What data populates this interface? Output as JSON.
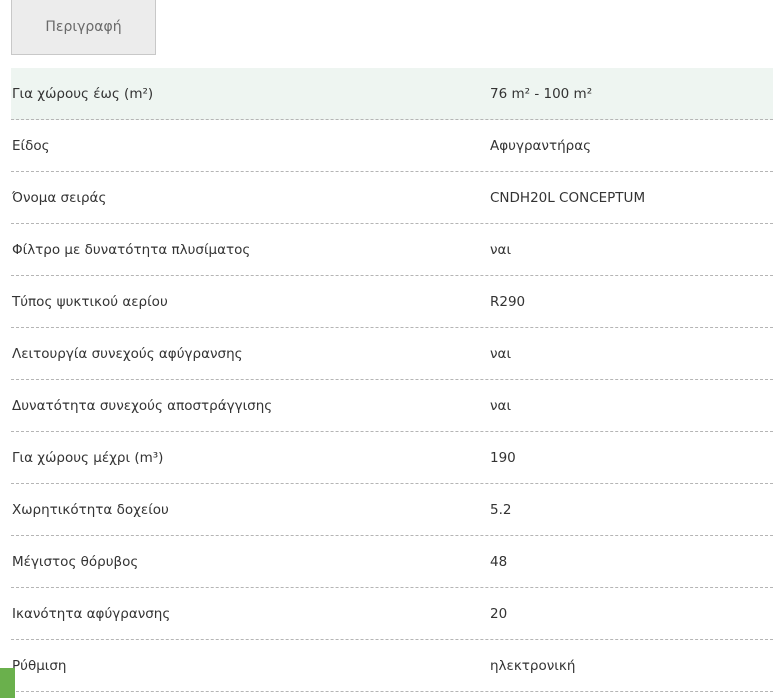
{
  "tabs": {
    "description_label": "Περιγραφή"
  },
  "specs": {
    "rows": [
      {
        "label": "Για χώρους έως (m²)",
        "value": "76 m² - 100 m²"
      },
      {
        "label": "Είδος",
        "value": "Αφυγραντήρας"
      },
      {
        "label": "Όνομα σειράς",
        "value": "CNDH20L CONCEPTUM"
      },
      {
        "label": "Φίλτρο με δυνατότητα πλυσίματος",
        "value": "ναι"
      },
      {
        "label": "Τύπος ψυκτικού αερίου",
        "value": "R290"
      },
      {
        "label": "Λειτουργία συνεχούς αφύγρανσης",
        "value": "ναι"
      },
      {
        "label": "Δυνατότητα συνεχούς αποστράγγισης",
        "value": "ναι"
      },
      {
        "label": "Για χώρους μέχρι (m³)",
        "value": "190"
      },
      {
        "label": "Χωρητικότητα δοχείου",
        "value": "5.2"
      },
      {
        "label": "Μέγιστος θόρυβος",
        "value": "48"
      },
      {
        "label": "Ικανότητα αφύγρανσης",
        "value": "20"
      },
      {
        "label": "Ρύθμιση",
        "value": "ηλεκτρονική"
      }
    ]
  },
  "colors": {
    "first_row_bg": "#eef5f1",
    "accent": "#6ab04c",
    "tab_bg": "#ececec"
  }
}
